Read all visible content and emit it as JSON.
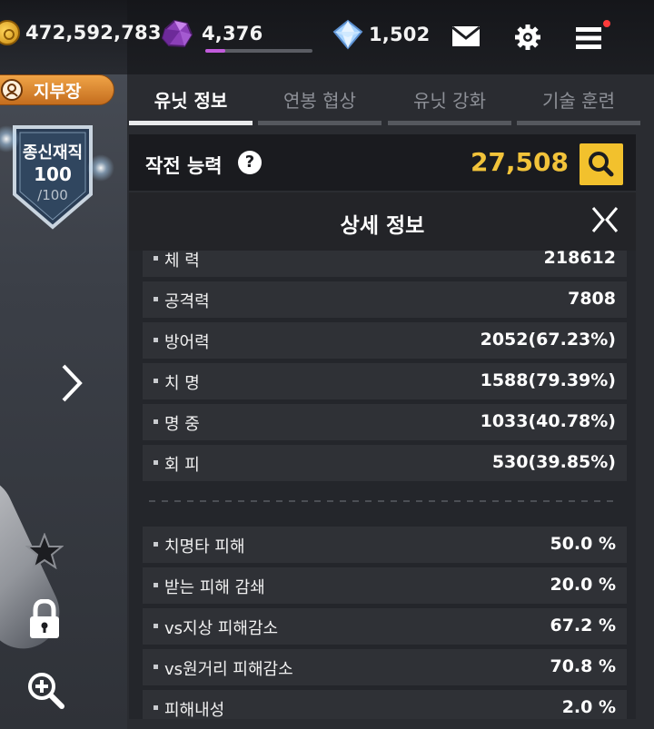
{
  "resources": {
    "gold": "472,592,783",
    "purple_crystal": "4,376",
    "purple_progress": 0.19,
    "diamond": "1,502"
  },
  "rank": {
    "label": "지부장"
  },
  "shield": {
    "title": "종신재직",
    "value": "100",
    "max": "/100"
  },
  "tabs": [
    {
      "label": "유닛 정보",
      "active": true
    },
    {
      "label": "연봉 협상",
      "active": false
    },
    {
      "label": "유닛 강화",
      "active": false
    },
    {
      "label": "기술 훈련",
      "active": false
    }
  ],
  "power": {
    "label": "작전 능력",
    "value": "27,508"
  },
  "detail": {
    "title": "상세 정보",
    "stats": [
      {
        "label": "체  력",
        "value": "218612"
      },
      {
        "label": "공격력",
        "value": "7808"
      },
      {
        "label": "방어력",
        "value": "2052(67.23%)"
      },
      {
        "label": "치  명",
        "value": "1588(79.39%)"
      },
      {
        "label": "명  중",
        "value": "1033(40.78%)"
      },
      {
        "label": "회  피",
        "value": "530(39.85%)"
      }
    ],
    "extra_stats": [
      {
        "label": "치명타 피해",
        "value": "50.0 %"
      },
      {
        "label": "받는 피해 감쇄",
        "value": "20.0 %"
      },
      {
        "label": "vs지상 피해감소",
        "value": "67.2 %"
      },
      {
        "label": "vs원거리 피해감소",
        "value": "70.8 %"
      },
      {
        "label": "피해내성",
        "value": "2.0 %"
      }
    ]
  },
  "colors": {
    "accent_gold": "#f2c33a",
    "rank_orange": "#e08a30",
    "notification": "#ff3b3b"
  }
}
